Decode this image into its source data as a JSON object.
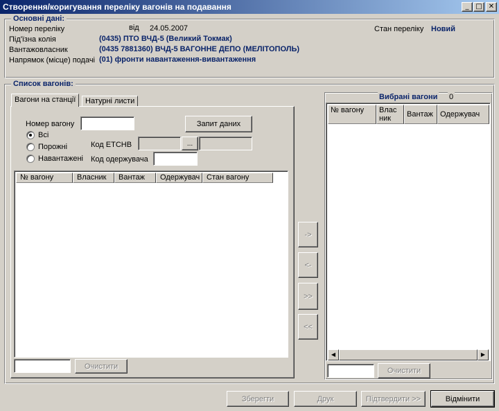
{
  "window": {
    "title": "Створення/коригування переліку вагонів на подавання",
    "minimize_glyph": "_",
    "maximize_glyph": "□",
    "close_glyph": "✕"
  },
  "main_data": {
    "group_title": "Основні дані:",
    "list_number_label": "Номер переліку",
    "from_label": "від",
    "date": "24.05.2007",
    "status_label": "Стан переліку",
    "status_value": "Новий",
    "siding_label": "Під'їзна колія",
    "siding_value": "(0435) ПТО ВЧД-5 (Великий Токмак)",
    "owner_label": "Вантажовласник",
    "owner_value": "(0435 7881360) ВЧД-5 ВАГОННЕ ДЕПО (МЕЛІТОПОЛЬ)",
    "direction_label": "Напрямок (місце) подачі",
    "direction_value": "(01) фронти навантаження-вивантаження"
  },
  "wagon_list": {
    "group_title": "Список вагонів:",
    "tabs": [
      {
        "label": "Вагони на станції",
        "active": true
      },
      {
        "label": "Натурні листи",
        "active": false
      }
    ],
    "wagon_number_label": "Номер вагону",
    "wagon_number_value": "",
    "query_button": "Запит даних",
    "radios": [
      {
        "label": "Всі",
        "checked": true
      },
      {
        "label": "Порожні",
        "checked": false
      },
      {
        "label": "Навантажені",
        "checked": false
      }
    ],
    "etsnv_label": "Код ЕТСНВ",
    "etsnv_browse": "...",
    "receiver_code_label": "Код одержувача",
    "receiver_code_value": "",
    "columns": [
      "№ вагону",
      "Власник",
      "Вантаж",
      "Одержувач",
      "Стан вагону"
    ],
    "rows": [],
    "filter_value": "",
    "clear_button": "Очистити"
  },
  "move_buttons": {
    "add_one": "->",
    "remove_one": "<-",
    "add_all": ">>",
    "remove_all": "<<"
  },
  "selected": {
    "title": "Вибрані вагони",
    "count": "0",
    "columns": [
      "№ вагону",
      "Влас ник",
      "Вантаж",
      "Одержувач"
    ],
    "rows": [],
    "filter_value": "",
    "clear_button": "Очистити",
    "scroll_left": "◀",
    "scroll_right": "▶"
  },
  "footer": {
    "save_button": "Зберегти",
    "print_button": "Друк",
    "confirm_button": "Підтвердити >>",
    "cancel_button": "Відмінити"
  }
}
